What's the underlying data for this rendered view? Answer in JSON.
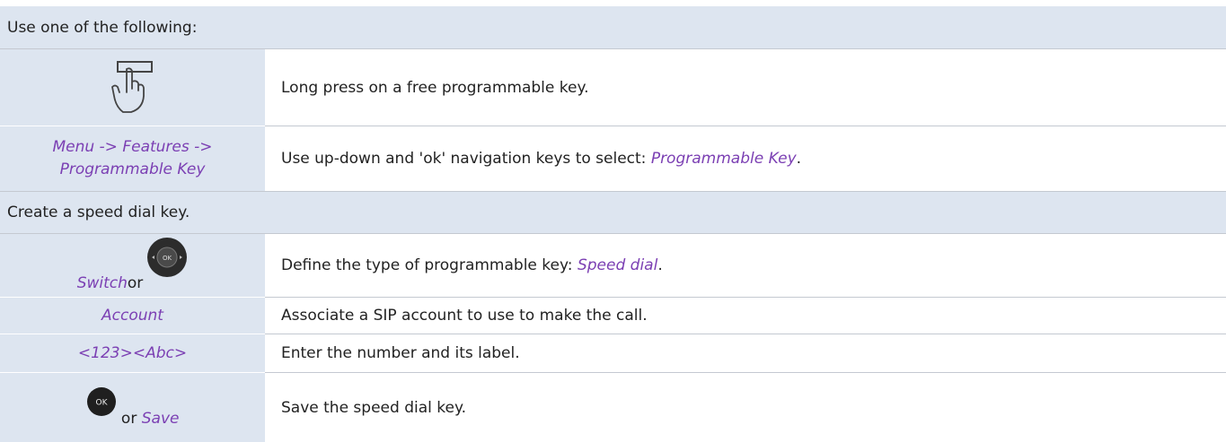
{
  "intro": "Use one of the following:",
  "rows_a": [
    {
      "left_kind": "press-key-icon",
      "text": "Long press on a free programmable key."
    },
    {
      "left_text": "Menu -> Features -> Programmable Key",
      "text_prefix": "Use up-down and 'ok' navigation keys to select: ",
      "text_highlight": "Programmable Key",
      "text_suffix": "."
    }
  ],
  "section": "Create a speed dial key.",
  "rows_b": [
    {
      "left_word": "Switch",
      "left_or": " or",
      "text_prefix": "Define the type of programmable key: ",
      "text_highlight": "Speed dial",
      "text_suffix": "."
    },
    {
      "left_text": "Account",
      "text": "Associate a SIP account to use to make the call."
    },
    {
      "left_text": "<123><Abc>",
      "text": "Enter the number and its label."
    },
    {
      "left_icon_label": "OK",
      "left_or": " or ",
      "left_word": "Save",
      "text": "Save the speed dial key."
    }
  ],
  "colors": {
    "band": "#dde5f0",
    "accent": "#7b3fb3",
    "line": "#c4c9d1"
  }
}
